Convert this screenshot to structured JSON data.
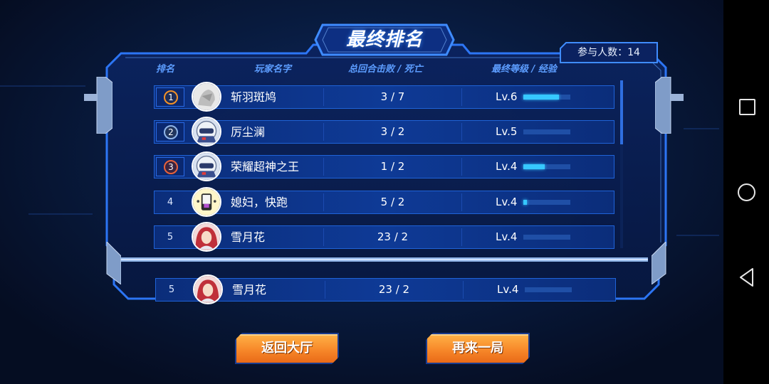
{
  "title": "最终排名",
  "participants_label": "参与人数：14",
  "headers": {
    "rank": "排名",
    "player_name": "玩家名字",
    "kd": "总回合击败 / 死亡",
    "level": "最终等级 / 经验"
  },
  "rows": [
    {
      "rank": "1",
      "rank_style": "gold",
      "name": "斩羽斑鸠",
      "kd": "3 / 7",
      "level": "Lv.6",
      "xp": 0.75,
      "avatar": "grey-sketch"
    },
    {
      "rank": "2",
      "rank_style": "silver",
      "name": "厉尘澜",
      "kd": "3 / 2",
      "level": "Lv.5",
      "xp": 0.0,
      "avatar": "helmet-robot"
    },
    {
      "rank": "3",
      "rank_style": "bronze",
      "name": "荣耀超神之王",
      "kd": "1 / 2",
      "level": "Lv.4",
      "xp": 0.45,
      "avatar": "helmet-robot"
    },
    {
      "rank": "4",
      "rank_style": "plain",
      "name": "媳妇，快跑",
      "kd": "5 / 2",
      "level": "Lv.4",
      "xp": 0.08,
      "avatar": "cartoon-yellow"
    },
    {
      "rank": "5",
      "rank_style": "plain",
      "name": "雪月花",
      "kd": "23 / 2",
      "level": "Lv.4",
      "xp": 0.0,
      "avatar": "red-hair-girl"
    }
  ],
  "self_row": {
    "rank": "5",
    "name": "雪月花",
    "kd": "23 / 2",
    "level": "Lv.4",
    "xp": 0.0,
    "avatar": "red-hair-girl"
  },
  "buttons": {
    "back_lobby": "返回大厅",
    "play_again": "再来一局"
  },
  "colors": {
    "accent_blue": "#2f6fe0",
    "row_bg": "#0e3a96",
    "xp_fill": "#36c8ff",
    "button_orange": "#f7882a"
  }
}
